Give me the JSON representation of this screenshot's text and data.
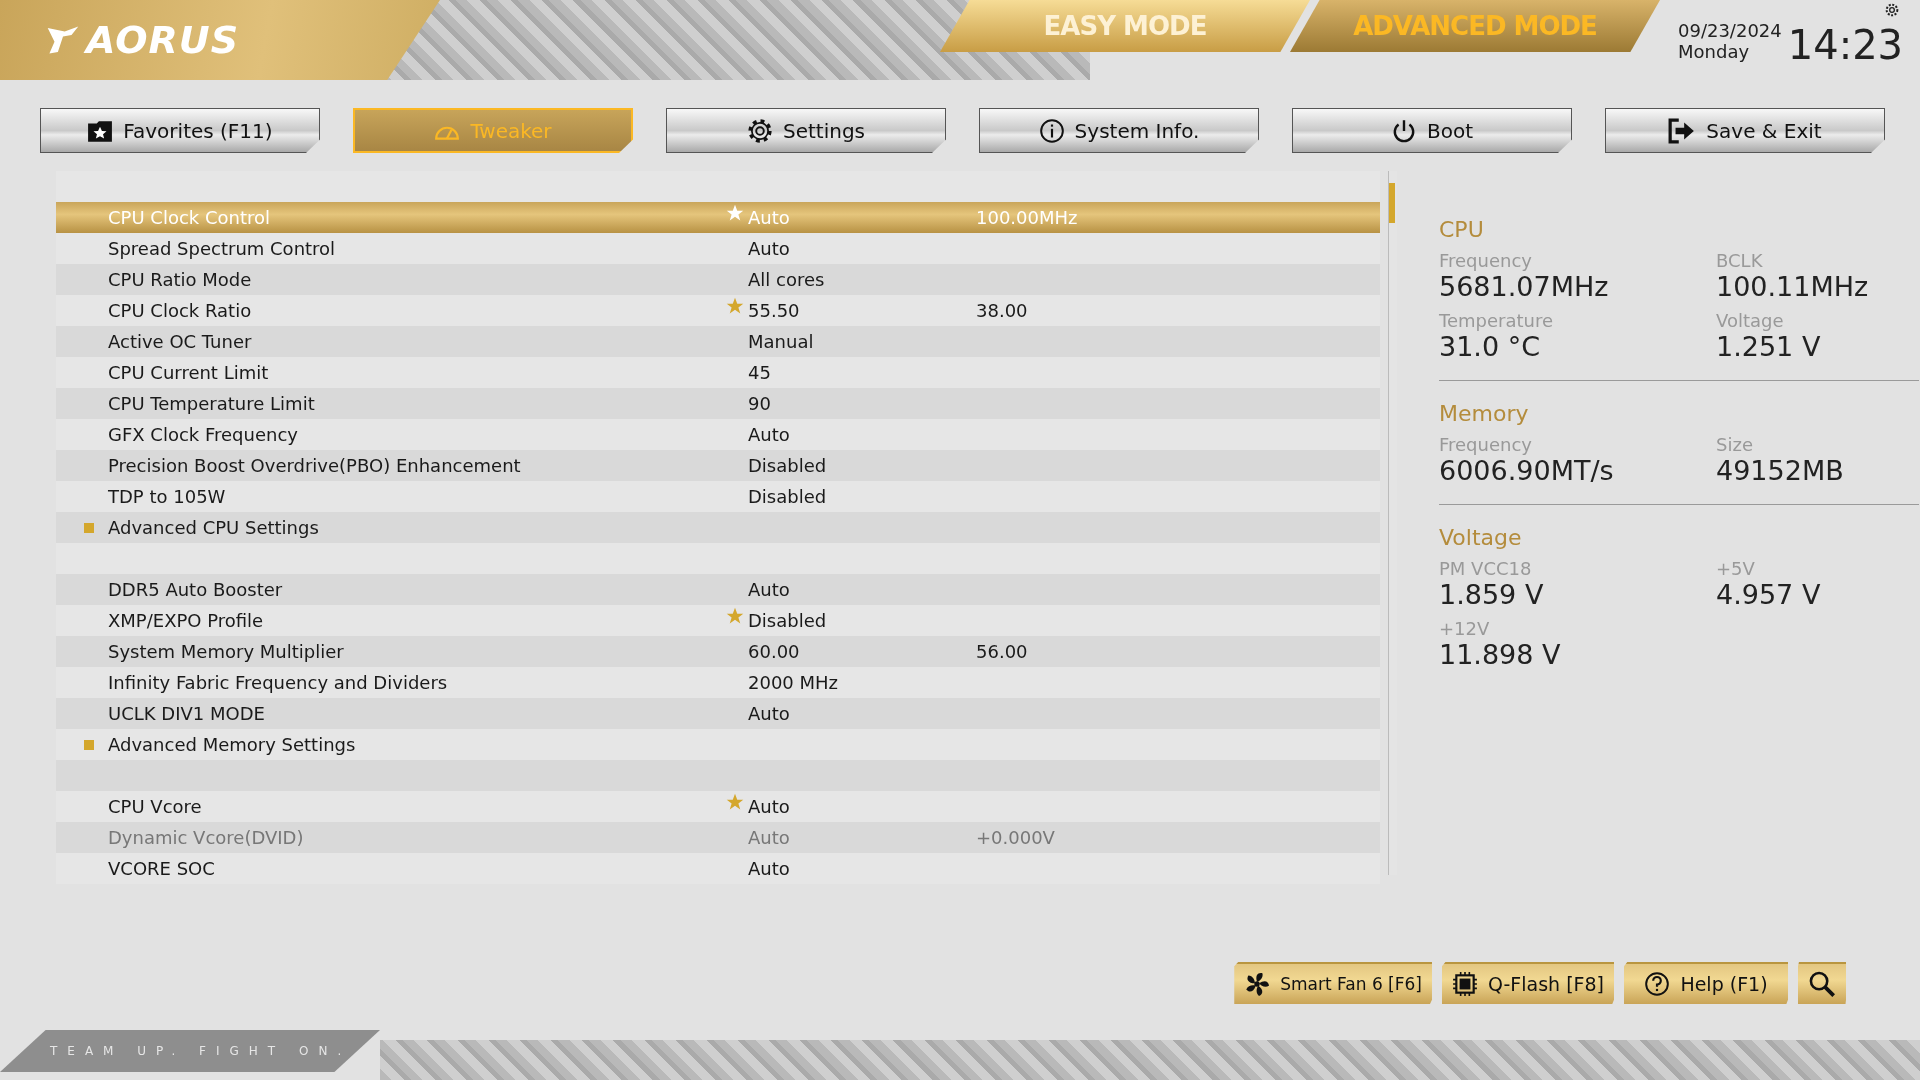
{
  "logo": {
    "text": "AORUS"
  },
  "modes": [
    {
      "label": "EASY MODE",
      "selected": false
    },
    {
      "label": "ADVANCED MODE",
      "selected": true
    }
  ],
  "clock": {
    "date": "09/23/2024",
    "weekday": "Monday",
    "time": "14:23"
  },
  "tabs": [
    {
      "label": "Favorites (F11)",
      "selected": false
    },
    {
      "label": "Tweaker",
      "selected": true
    },
    {
      "label": "Settings",
      "selected": false
    },
    {
      "label": "System Info.",
      "selected": false
    },
    {
      "label": "Boot",
      "selected": false
    },
    {
      "label": "Save & Exit",
      "selected": false
    }
  ],
  "settings": [
    {
      "kind": "item",
      "label": "CPU Clock Control",
      "favorite": true,
      "value": "Auto",
      "value2": "100.00MHz",
      "selected": true,
      "disabled": false
    },
    {
      "kind": "item",
      "label": "Spread Spectrum Control",
      "favorite": false,
      "value": "Auto",
      "selected": false,
      "disabled": false
    },
    {
      "kind": "item",
      "label": "CPU Ratio Mode",
      "favorite": false,
      "value": "All cores",
      "selected": false,
      "disabled": false
    },
    {
      "kind": "item",
      "label": "CPU Clock Ratio",
      "favorite": true,
      "value": "55.50",
      "value2": "38.00",
      "selected": false,
      "disabled": false
    },
    {
      "kind": "item",
      "label": "Active OC Tuner",
      "favorite": false,
      "value": "Manual",
      "selected": false,
      "disabled": false
    },
    {
      "kind": "item",
      "label": "CPU Current Limit",
      "favorite": false,
      "value": "45",
      "selected": false,
      "disabled": false
    },
    {
      "kind": "item",
      "label": "CPU Temperature Limit",
      "favorite": false,
      "value": "90",
      "selected": false,
      "disabled": false
    },
    {
      "kind": "item",
      "label": "GFX Clock Frequency",
      "favorite": false,
      "value": "Auto",
      "selected": false,
      "disabled": false
    },
    {
      "kind": "item",
      "label": "Precision Boost Overdrive(PBO) Enhancement",
      "favorite": false,
      "value": "Disabled",
      "selected": false,
      "disabled": false
    },
    {
      "kind": "item",
      "label": "TDP to 105W",
      "favorite": false,
      "value": "Disabled",
      "selected": false,
      "disabled": false
    },
    {
      "kind": "submenu",
      "label": "Advanced CPU Settings",
      "selected": false
    },
    {
      "kind": "spacer"
    },
    {
      "kind": "item",
      "label": "DDR5 Auto Booster",
      "favorite": false,
      "value": "Auto",
      "selected": false,
      "disabled": false
    },
    {
      "kind": "item",
      "label": "XMP/EXPO Profile",
      "favorite": true,
      "value": "Disabled",
      "selected": false,
      "disabled": false
    },
    {
      "kind": "item",
      "label": "System Memory Multiplier",
      "favorite": false,
      "value": "60.00",
      "value2": "56.00",
      "selected": false,
      "disabled": false
    },
    {
      "kind": "item",
      "label": "Infinity Fabric Frequency and Dividers",
      "favorite": false,
      "value": "2000 MHz",
      "selected": false,
      "disabled": false
    },
    {
      "kind": "item",
      "label": "UCLK DIV1 MODE",
      "favorite": false,
      "value": "Auto",
      "selected": false,
      "disabled": false
    },
    {
      "kind": "submenu",
      "label": "Advanced Memory Settings",
      "selected": false
    },
    {
      "kind": "spacer"
    },
    {
      "kind": "item",
      "label": "CPU Vcore",
      "favorite": true,
      "value": "Auto",
      "selected": false,
      "disabled": false
    },
    {
      "kind": "item",
      "label": "Dynamic Vcore(DVID)",
      "favorite": false,
      "value": "Auto",
      "value2": "+0.000V",
      "selected": false,
      "disabled": true
    },
    {
      "kind": "item",
      "label": "VCORE SOC",
      "favorite": false,
      "value": "Auto",
      "selected": false,
      "disabled": false
    }
  ],
  "monitor": [
    {
      "title": "CPU",
      "readings": [
        {
          "label": "Frequency",
          "value": "5681.07MHz"
        },
        {
          "label": "BCLK",
          "value": "100.11MHz"
        },
        {
          "label": "Temperature",
          "value": "31.0 °C"
        },
        {
          "label": "Voltage",
          "value": "1.251 V"
        }
      ]
    },
    {
      "title": "Memory",
      "readings": [
        {
          "label": "Frequency",
          "value": "6006.90MT/s"
        },
        {
          "label": "Size",
          "value": "49152MB"
        }
      ]
    },
    {
      "title": "Voltage",
      "readings": [
        {
          "label": "PM VCC18",
          "value": "1.859 V"
        },
        {
          "label": "+5V",
          "value": "4.957 V"
        },
        {
          "label": "+12V",
          "value": "11.898 V"
        }
      ]
    }
  ],
  "tools": [
    "Smart Fan 6 [F6]",
    "Q-Flash [F8]",
    "Help (F1)"
  ],
  "slogan": "TEAM UP. FIGHT ON."
}
